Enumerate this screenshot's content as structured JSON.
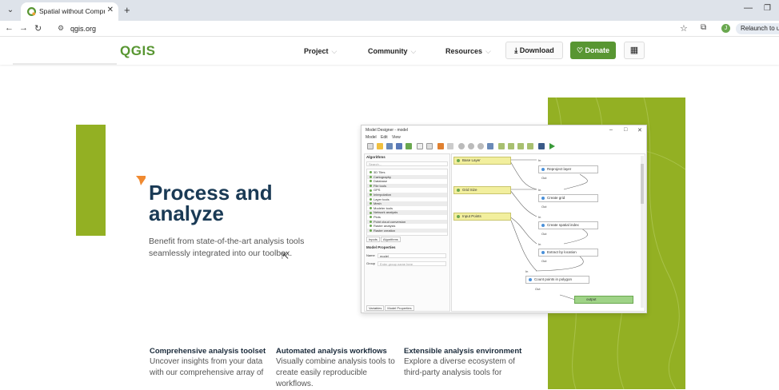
{
  "browser": {
    "tab_title": "Spatial without Compromise · Q",
    "url": "qgis.org",
    "relaunch_label": "Relaunch to updat",
    "avatar_letter": "J"
  },
  "header": {
    "logo": "QGIS",
    "nav": [
      {
        "label": "Project"
      },
      {
        "label": "Community"
      },
      {
        "label": "Resources"
      }
    ],
    "download_label": "Download",
    "donate_label": "Donate",
    "accent_color": "#589632"
  },
  "hero": {
    "headline_line1": "Process and",
    "headline_line2": "analyze",
    "subtext": "Benefit from state-of-the-art analysis tools seamlessly integrated into our toolbox.",
    "decor_color": "#93b023"
  },
  "model_designer": {
    "title": "Model Designer - model",
    "menu": "Model Edit View",
    "algorithms_title": "Algorithms",
    "search_placeholder": "Search...",
    "algorithms": [
      "3D Tiles",
      "Cartography",
      "Database",
      "File tools",
      "GPS",
      "Interpolation",
      "Layer tools",
      "Mesh",
      "Modeler tools",
      "Network analysis",
      "Plots",
      "Point cloud conversion",
      "Raster analysis",
      "Raster creation"
    ],
    "tabs": [
      "Inputs",
      "Algorithms"
    ],
    "props_title": "Model Properties",
    "name_label": "Name",
    "name_value": "model",
    "group_label": "Group",
    "group_placeholder": "Enter group name here",
    "bottom_tabs": [
      "Variables",
      "Model Properties"
    ],
    "inputs": [
      "Base Layer",
      "Grid Size",
      "Input Points"
    ],
    "algos": [
      "Reproject layer",
      "Create grid",
      "Create spatial index",
      "Extract by location",
      "Count points in polygon"
    ],
    "output": "output",
    "port_in": "In",
    "port_out": "Out"
  },
  "features": [
    {
      "title": "Comprehensive analysis toolset",
      "text": "Uncover insights from your data with our comprehensive array of"
    },
    {
      "title": "Automated analysis workflows",
      "text": "Visually combine analysis tools to create easily reproducible workflows."
    },
    {
      "title": "Extensible analysis environment",
      "text": "Explore a diverse ecosystem of third-party analysis tools for"
    }
  ]
}
